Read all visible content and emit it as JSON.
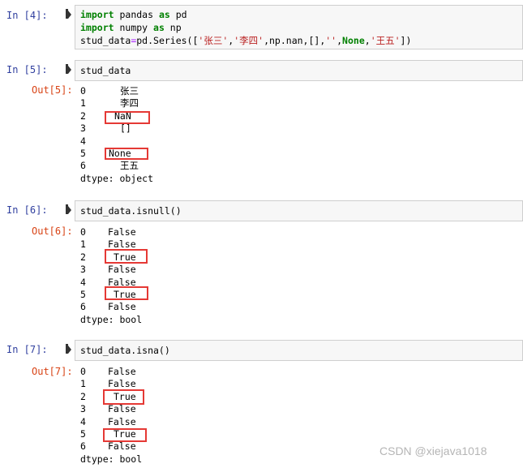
{
  "cells": [
    {
      "in_prompt": "In  [4]:",
      "code_lines": [
        [
          {
            "t": "import",
            "c": "kw"
          },
          {
            "t": " pandas "
          },
          {
            "t": "as",
            "c": "kw"
          },
          {
            "t": " pd"
          }
        ],
        [
          {
            "t": "import",
            "c": "kw"
          },
          {
            "t": " numpy "
          },
          {
            "t": "as",
            "c": "kw"
          },
          {
            "t": " np"
          }
        ],
        [
          {
            "t": "stud_data"
          },
          {
            "t": "=",
            "c": "op"
          },
          {
            "t": "pd.Series(["
          },
          {
            "t": "'张三'",
            "c": "str"
          },
          {
            "t": ","
          },
          {
            "t": "'李四'",
            "c": "str"
          },
          {
            "t": ",np.nan,[],"
          },
          {
            "t": "''",
            "c": "str"
          },
          {
            "t": ","
          },
          {
            "t": "None",
            "c": "kw"
          },
          {
            "t": ","
          },
          {
            "t": "'王五'",
            "c": "str"
          },
          {
            "t": "])"
          }
        ]
      ]
    },
    {
      "in_prompt": "In  [5]:",
      "code": "stud_data",
      "out_prompt": "Out[5]:",
      "output_lines": [
        {
          "idx": "0",
          "val": "张三"
        },
        {
          "idx": "1",
          "val": "李四"
        },
        {
          "idx": "2",
          "val": "NaN"
        },
        {
          "idx": "3",
          "val": "[]"
        },
        {
          "idx": "4",
          "val": ""
        },
        {
          "idx": "5",
          "val": "None"
        },
        {
          "idx": "6",
          "val": "王五"
        }
      ],
      "dtype": "dtype: object"
    },
    {
      "in_prompt": "In  [6]:",
      "code": "stud_data.isnull()",
      "out_prompt": "Out[6]:",
      "output_lines": [
        {
          "idx": "0",
          "val": "False"
        },
        {
          "idx": "1",
          "val": "False"
        },
        {
          "idx": "2",
          "val": "True"
        },
        {
          "idx": "3",
          "val": "False"
        },
        {
          "idx": "4",
          "val": "False"
        },
        {
          "idx": "5",
          "val": "True"
        },
        {
          "idx": "6",
          "val": "False"
        }
      ],
      "dtype": "dtype: bool"
    },
    {
      "in_prompt": "In  [7]:",
      "code": "stud_data.isna()",
      "out_prompt": "Out[7]:",
      "output_lines": [
        {
          "idx": "0",
          "val": "False"
        },
        {
          "idx": "1",
          "val": "False"
        },
        {
          "idx": "2",
          "val": "True"
        },
        {
          "idx": "3",
          "val": "False"
        },
        {
          "idx": "4",
          "val": "False"
        },
        {
          "idx": "5",
          "val": "True"
        },
        {
          "idx": "6",
          "val": "False"
        }
      ],
      "dtype": "dtype: bool"
    }
  ],
  "watermark": "CSDN @xiejava1018",
  "colors": {
    "highlight_box": "#e53935",
    "in_prompt": "#303f9f",
    "out_prompt": "#d84315"
  }
}
